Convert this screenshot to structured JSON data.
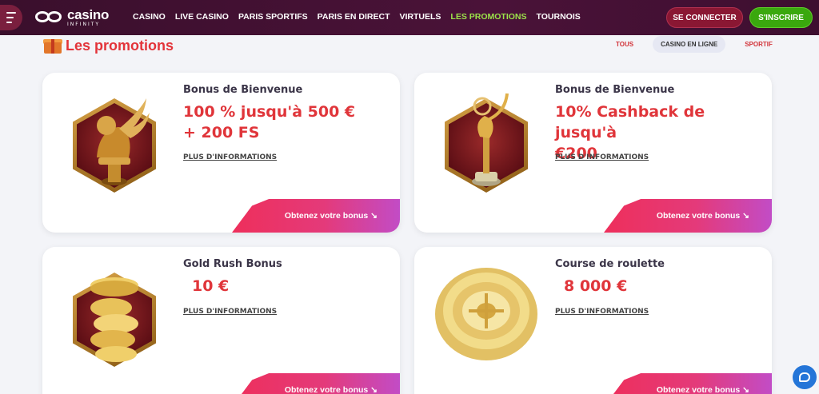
{
  "header": {
    "logo_main": "casino",
    "logo_sub": "INFINITY",
    "nav": [
      "CASINO",
      "LIVE CASINO",
      "PARIS SPORTIFS",
      "PARIS EN DIRECT",
      "VIRTUELS",
      "LES PROMOTIONS",
      "TOURNOIS"
    ],
    "active_nav": "LES PROMOTIONS",
    "login_label": "SE CONNECTER",
    "signup_label": "S'INSCRIRE"
  },
  "page": {
    "title": "Les promotions",
    "filters": [
      "TOUS",
      "CASINO EN LIGNE",
      "SPORTIF"
    ],
    "active_filter": "CASINO EN LIGNE"
  },
  "cards": [
    {
      "subtitle": "Bonus de Bienvenue",
      "amount_line1": "100 % jusqu'à 500 €",
      "amount_line2": "+ 200 FS",
      "more": "PLUS D'INFORMATIONS",
      "cta": "Obtenez votre bonus ↘",
      "image": "golden-lion-icon"
    },
    {
      "subtitle": "Bonus de Bienvenue",
      "amount_line1": "10% Cashback de jusqu'à",
      "amount_line2": "€200",
      "more": "PLUS D'INFORMATIONS",
      "cta": "Obtenez votre bonus ↘",
      "image": "golden-trophy-icon"
    },
    {
      "subtitle": "Gold Rush Bonus",
      "amount_line1": "10 €",
      "more": "PLUS D'INFORMATIONS",
      "cta": "Obtenez votre bonus ↘",
      "image": "gold-coins-icon"
    },
    {
      "subtitle": "Course de roulette",
      "amount_line1": "8 000 €",
      "more": "PLUS D'INFORMATIONS",
      "cta": "Obtenez votre bonus ↘",
      "image": "roulette-wheel-icon"
    }
  ],
  "colors": {
    "header_bg": "#3a0f2c",
    "active_nav": "#9be34a",
    "accent_red": "#e0353a",
    "signup_green": "#3aa80e",
    "chat_blue": "#2475d8"
  }
}
